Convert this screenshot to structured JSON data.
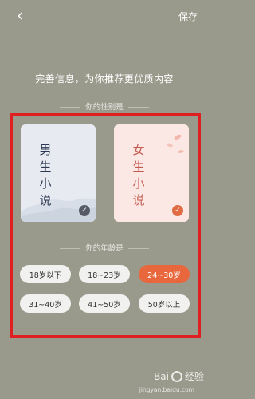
{
  "header": {
    "back_icon": "chevron-left-icon",
    "back_glyph": "‹",
    "save_label": "保存"
  },
  "headline": "完善信息，为你推荐更优质内容",
  "gender_section": {
    "title": "你的性别是",
    "options": [
      {
        "lines": [
          "男",
          "生",
          "小",
          "说"
        ],
        "selected": true
      },
      {
        "lines": [
          "女",
          "生",
          "小",
          "说"
        ],
        "selected": true
      }
    ]
  },
  "age_section": {
    "title": "你的年龄是",
    "options": [
      "18岁以下",
      "18~23岁",
      "24~30岁",
      "31~40岁",
      "41~50岁",
      "50岁以上"
    ],
    "selected": "24~30岁"
  },
  "check_glyph": "✓",
  "watermark": {
    "brand_left": "Bai",
    "brand_right": "经验",
    "url": "jingyan.baidu.com"
  },
  "colors": {
    "background": "#9a9a8c",
    "accent": "#e8673d",
    "highlight_box": "#e02020"
  }
}
